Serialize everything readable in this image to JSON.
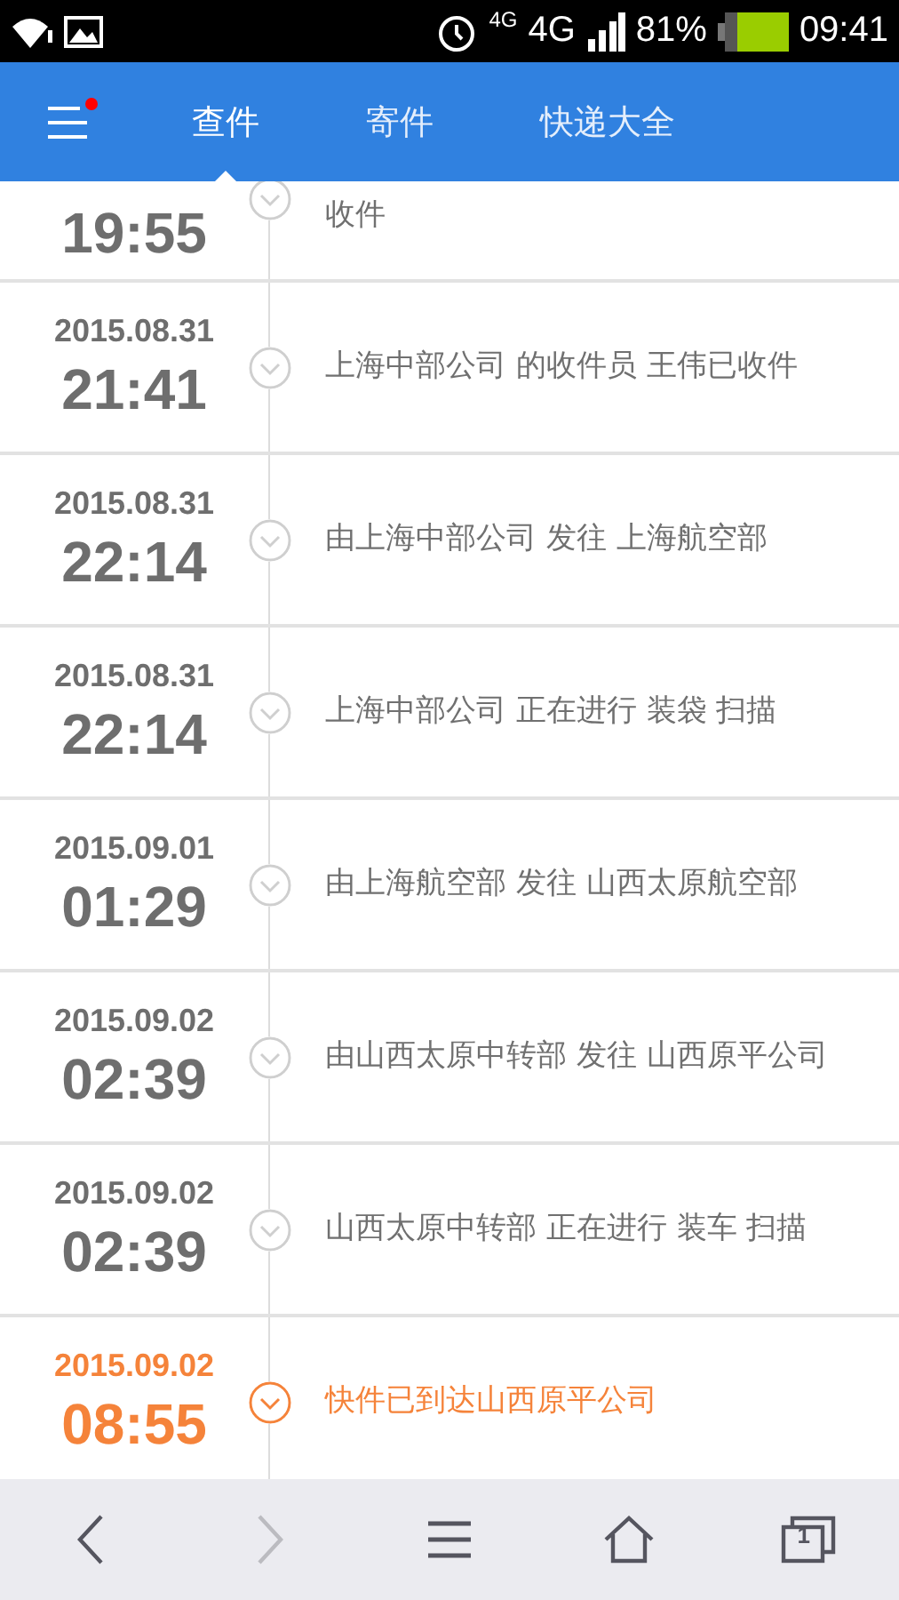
{
  "status_bar": {
    "network_small": "4G",
    "network": "4G",
    "battery": "81%",
    "time": "09:41"
  },
  "header": {
    "menu_notification": true,
    "tabs": [
      {
        "label": "查件",
        "selected": true
      },
      {
        "label": "寄件",
        "selected": false
      },
      {
        "label": "快递大全",
        "selected": false
      }
    ]
  },
  "events": [
    {
      "time": "19:55",
      "text": "收件",
      "current": false
    },
    {
      "date": "2015.08.31",
      "time": "21:41",
      "text": "上海中部公司 的收件员 王伟已收件",
      "current": false
    },
    {
      "date": "2015.08.31",
      "time": "22:14",
      "text": "由上海中部公司 发往 上海航空部",
      "current": false
    },
    {
      "date": "2015.08.31",
      "time": "22:14",
      "text": "上海中部公司 正在进行 装袋 扫描",
      "current": false
    },
    {
      "date": "2015.09.01",
      "time": "01:29",
      "text": "由上海航空部 发往 山西太原航空部",
      "current": false
    },
    {
      "date": "2015.09.02",
      "time": "02:39",
      "text": "由山西太原中转部 发往 山西原平公司",
      "current": false
    },
    {
      "date": "2015.09.02",
      "time": "02:39",
      "text": "山西太原中转部 正在进行 装车 扫描",
      "current": false
    },
    {
      "date": "2015.09.02",
      "time": "08:55",
      "text": "快件已到达山西原平公司",
      "current": true
    }
  ],
  "nav": [
    {
      "kind": "back",
      "disabled": false
    },
    {
      "kind": "forward",
      "disabled": true
    },
    {
      "kind": "menu",
      "disabled": false
    },
    {
      "kind": "home",
      "disabled": false
    },
    {
      "kind": "tabs",
      "disabled": false,
      "count": "1"
    }
  ]
}
